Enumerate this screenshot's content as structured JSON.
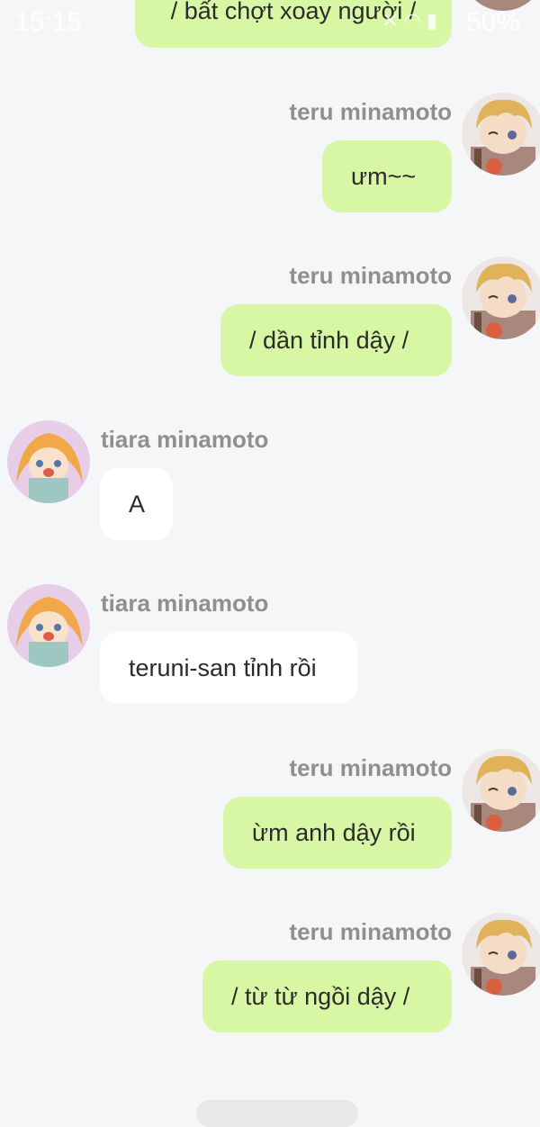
{
  "status_bar": {
    "time": "15:15",
    "battery": "50%"
  },
  "colors": {
    "outgoing_bubble": "#d8f7a4",
    "incoming_bubble": "#ffffff",
    "background": "#f5f6f8",
    "name": "#8f8f8f"
  },
  "top_message": {
    "text": "/ bất chợt xoay người /"
  },
  "messages": [
    {
      "sender": "teru minamoto",
      "text": "ưm~~",
      "direction": "out",
      "avatar": "teru-avatar"
    },
    {
      "sender": "teru minamoto",
      "text": "/ dần tỉnh dậy /",
      "direction": "out",
      "avatar": "teru-avatar"
    },
    {
      "sender": "tiara minamoto",
      "text": "A",
      "direction": "in",
      "avatar": "tiara-avatar"
    },
    {
      "sender": "tiara minamoto",
      "text": "teruni-san tỉnh rồi",
      "direction": "in",
      "avatar": "tiara-avatar"
    },
    {
      "sender": "teru minamoto",
      "text": "ừm anh dậy rồi",
      "direction": "out",
      "avatar": "teru-avatar"
    },
    {
      "sender": "teru minamoto",
      "text": "/ từ từ ngồi dậy /",
      "direction": "out",
      "avatar": "teru-avatar"
    }
  ]
}
